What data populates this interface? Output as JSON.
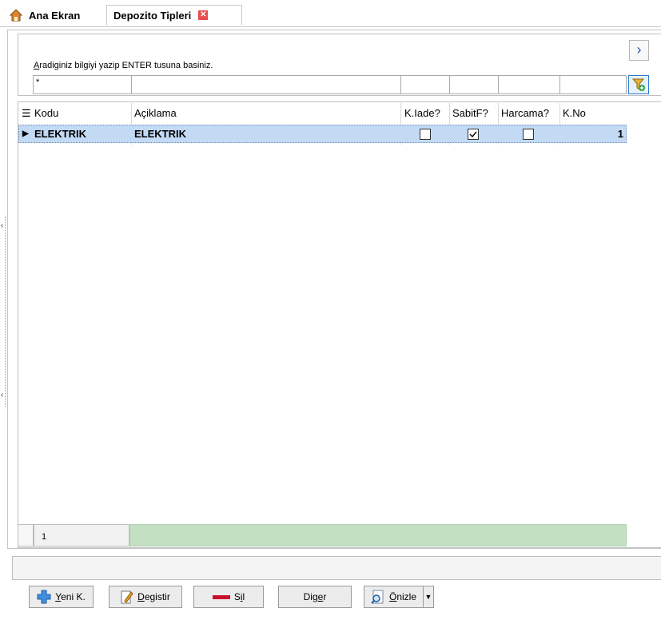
{
  "tabs": [
    {
      "label": "Ana Ekran",
      "icon": "home-icon"
    },
    {
      "label": "Depozito Tipleri",
      "icon": "close-icon"
    }
  ],
  "search": {
    "label_first": "A",
    "label_rest": "radiginiz bilgiyi yazip ENTER tusuna basiniz.",
    "filter_value": "*"
  },
  "grid": {
    "columns": [
      "Kodu",
      "Açiklama",
      "K.Iade?",
      "SabitF?",
      "Harcama?",
      "K.No"
    ],
    "rows": [
      {
        "kodu": "ELEKTRIK",
        "aciklama": "ELEKTRIK",
        "kiade": false,
        "sabitf": true,
        "harcama": false,
        "kno": "1"
      }
    ],
    "footer_count": "1"
  },
  "buttons": {
    "yeni_first": "Y",
    "yeni_rest": "eni K.",
    "degistir_first": "D",
    "degistir_rest": "egistir",
    "sil_pre": "S",
    "sil_u": "i",
    "sil_post": "l",
    "diger_pre": "Dig",
    "diger_u": "e",
    "diger_post": "r",
    "onizle_u": "Ö",
    "onizle_rest": "nizle"
  },
  "colors": {
    "selected_row": "#c3daf5",
    "footer_green": "#c3e0c3",
    "accent": "#1f5fb8"
  }
}
